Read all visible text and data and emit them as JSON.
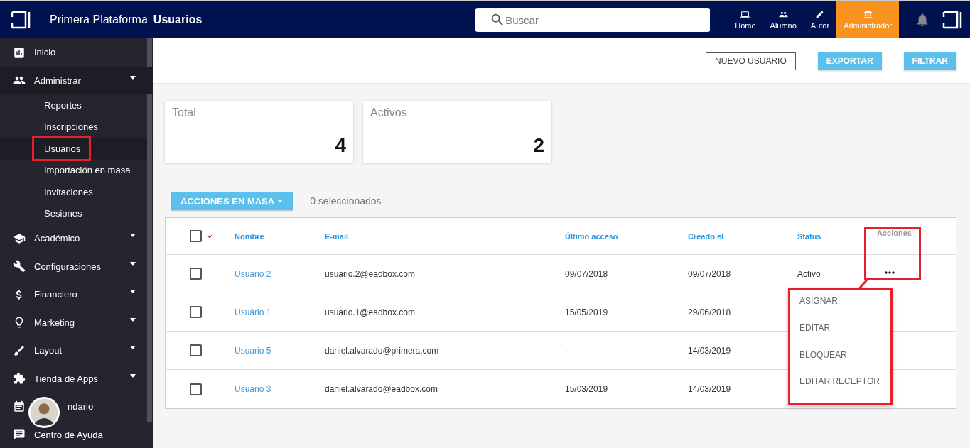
{
  "header": {
    "brand": "Primera Plataforma",
    "page_title": "Usuarios",
    "search": {
      "placeholder": "Buscar"
    },
    "nav": [
      {
        "label": "Home",
        "selected": false
      },
      {
        "label": "Alumno",
        "selected": false
      },
      {
        "label": "Autor",
        "selected": false
      },
      {
        "label": "Administrador",
        "selected": true
      }
    ]
  },
  "sidebar": {
    "items": [
      {
        "label": "Inicio"
      },
      {
        "label": "Administrar",
        "expanded": true,
        "children": [
          {
            "label": "Reportes",
            "selected": false
          },
          {
            "label": "Inscripciones",
            "selected": false
          },
          {
            "label": "Usuarios",
            "selected": true,
            "highlighted": true
          },
          {
            "label": "Importación en masa",
            "selected": false
          },
          {
            "label": "Invitaciones",
            "selected": false
          },
          {
            "label": "Sesiones",
            "selected": false
          }
        ]
      },
      {
        "label": "Académico",
        "expanded": false
      },
      {
        "label": "Configuraciones",
        "expanded": false
      },
      {
        "label": "Financiero",
        "expanded": false
      },
      {
        "label": "Marketing",
        "expanded": false
      },
      {
        "label": "Layout",
        "expanded": false
      },
      {
        "label": "Tienda de Apps",
        "expanded": false
      },
      {
        "label": "ndario"
      },
      {
        "label": "Centro de Ayuda"
      }
    ]
  },
  "toolbar": {
    "buttons": [
      {
        "label": "NUEVO USUARIO",
        "kind": "outline"
      },
      {
        "label": "EXPORTAR",
        "kind": "filled"
      },
      {
        "label": "FILTRAR",
        "kind": "filled"
      }
    ]
  },
  "stats": [
    {
      "label": "Total",
      "value": "4"
    },
    {
      "label": "Activos",
      "value": "2"
    }
  ],
  "bulk": {
    "button": "ACCIONES EN MASA",
    "count": "0 seleccionados"
  },
  "table": {
    "select_all": {
      "checked": false
    },
    "columns": [
      {
        "label": "Nombre"
      },
      {
        "label": "E-mail"
      },
      {
        "label": "Último acceso"
      },
      {
        "label": "Creado el"
      },
      {
        "label": "Status"
      },
      {
        "label": "Acciones",
        "muted": true,
        "highlighted": true
      }
    ],
    "rows": [
      {
        "checked": false,
        "name": "Usuário 2",
        "email": "usuario.2@eadbox.com",
        "last_access": "09/07/2018",
        "created": "09/07/2018",
        "status": "Activo",
        "menu_open": true
      },
      {
        "checked": false,
        "name": "Usuário 1",
        "email": "usuario.1@eadbox.com",
        "last_access": "15/05/2019",
        "created": "29/06/2018",
        "menu_open": false
      },
      {
        "checked": false,
        "name": "Usuario 5",
        "email": "daniel.alvarado@primera.com",
        "last_access": "-",
        "created": "14/03/2019",
        "menu_open": false
      },
      {
        "checked": false,
        "name": "Usuario 3",
        "email": "daniel.alvarado@eadbox.com",
        "last_access": "15/03/2019",
        "created": "14/03/2019",
        "menu_open": false
      }
    ],
    "action_menu": {
      "highlighted": true,
      "items": [
        "ASIGNAR",
        "EDITAR",
        "BLOQUEAR",
        "EDITAR RECEPTOR"
      ]
    }
  }
}
